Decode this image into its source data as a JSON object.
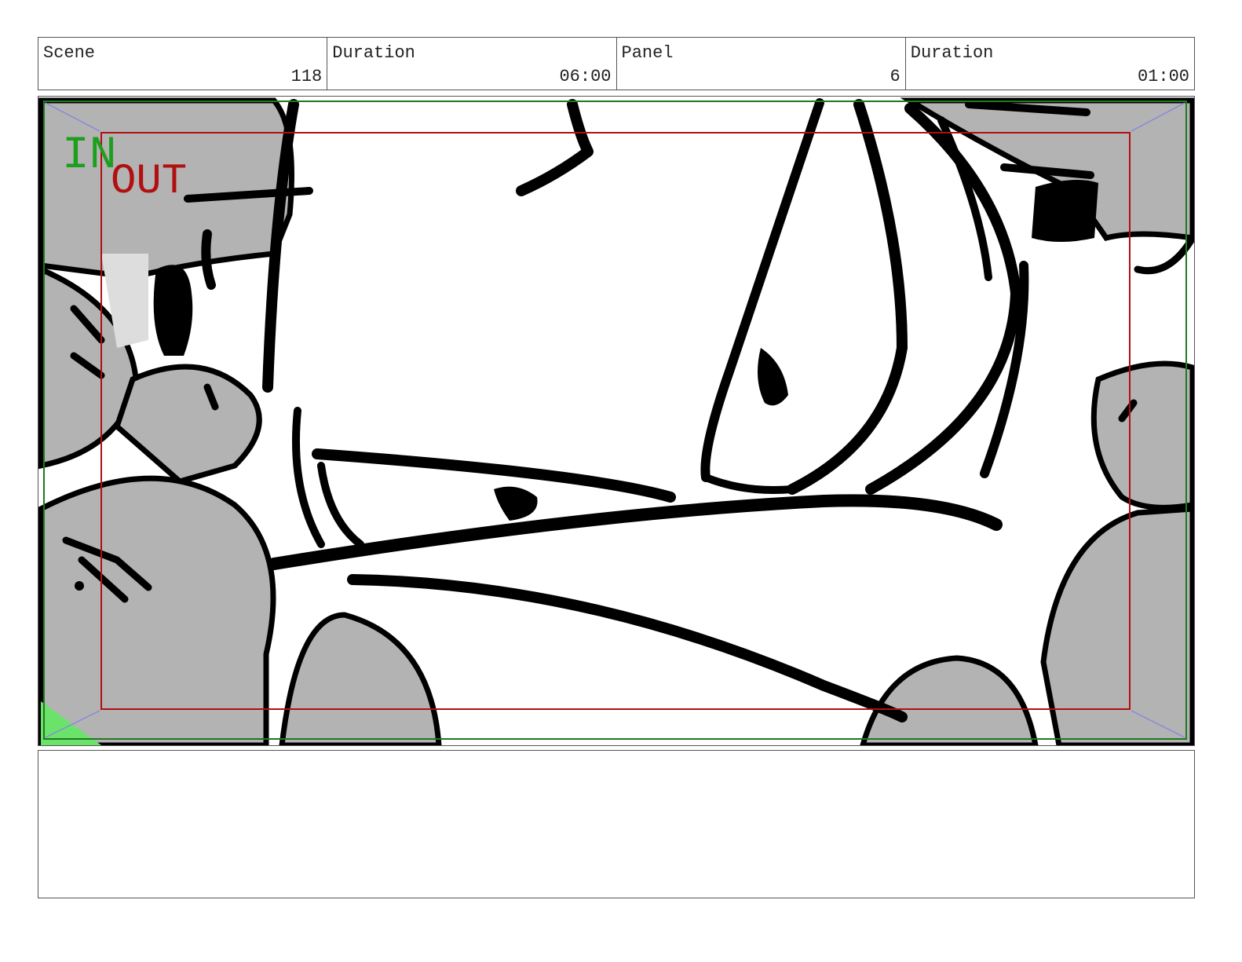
{
  "header": {
    "scene_label": "Scene",
    "scene_value": "118",
    "scene_duration_label": "Duration",
    "scene_duration_value": "06:00",
    "panel_label": "Panel",
    "panel_value": "6",
    "panel_duration_label": "Duration",
    "panel_duration_value": "01:00"
  },
  "frame": {
    "in_label": "IN",
    "out_label": "OUT",
    "in_color": "#1e9e1e",
    "out_color": "#b01010"
  },
  "notes": {
    "text": ""
  }
}
